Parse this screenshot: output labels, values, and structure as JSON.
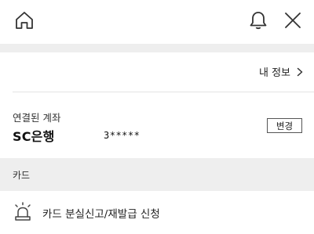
{
  "icons": {
    "home": "home-icon",
    "bell": "bell-icon",
    "close": "close-icon",
    "chevron": "chevron-right-icon",
    "siren": "siren-icon"
  },
  "profile": {
    "my_info_label": "내 정보"
  },
  "account": {
    "section_label": "연결된 계좌",
    "bank_name": "SC은행",
    "account_number_masked": "3*****",
    "change_button_label": "변경"
  },
  "card_section": {
    "title": "카드",
    "items": [
      {
        "label": "카드 분실신고/재발급 신청",
        "icon": "siren-icon"
      }
    ]
  }
}
